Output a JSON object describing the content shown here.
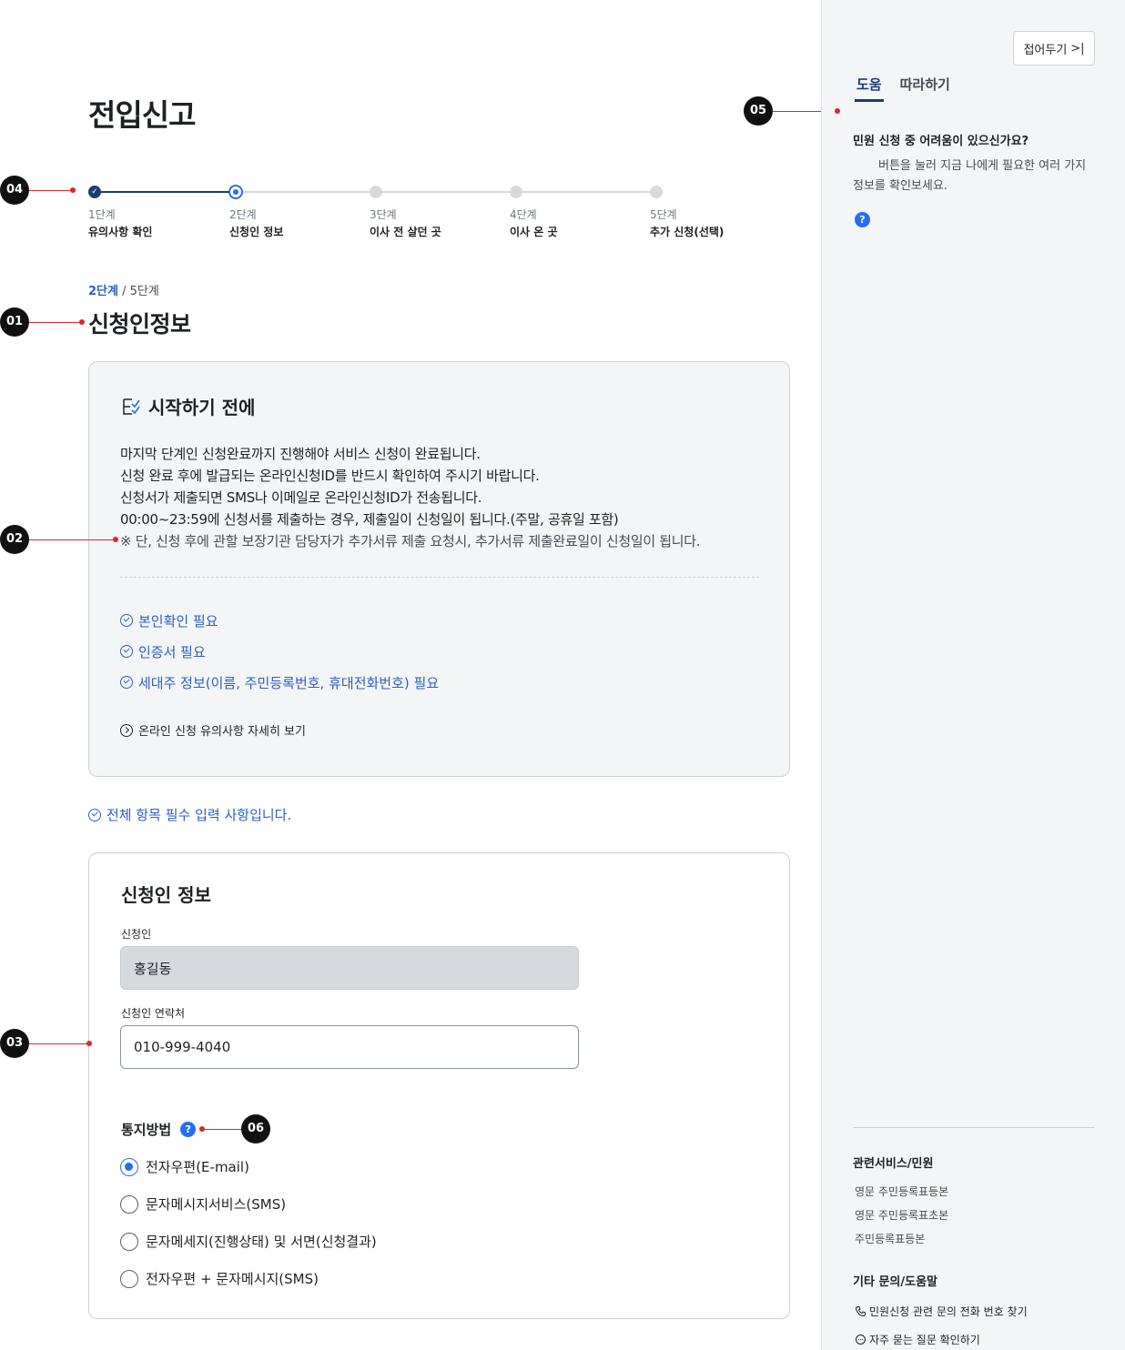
{
  "page": {
    "title": "전입신고"
  },
  "stepper": {
    "steps": [
      {
        "num": "1단계",
        "label": "유의사항 확인",
        "state": "done"
      },
      {
        "num": "2단계",
        "label": "신청인 정보",
        "state": "current"
      },
      {
        "num": "3단계",
        "label": "이사 전 살던 곳",
        "state": "todo"
      },
      {
        "num": "4단계",
        "label": "이사 온 곳",
        "state": "todo"
      },
      {
        "num": "5단계",
        "label": "추가 신청(선택)",
        "state": "todo"
      }
    ],
    "current_label": "2단계",
    "total_label": "5단계",
    "separator": "/"
  },
  "section": {
    "title": "신청인정보"
  },
  "notice": {
    "title": "시작하기 전에",
    "lines": [
      "마지막 단계인 신청완료까지 진행해야 서비스 신청이 완료됩니다.",
      "신청 완료 후에 발급되는 온라인신청ID를 반드시 확인하여 주시기 바랍니다.",
      "신청서가 제출되면 SMS나 이메일로 온라인신청ID가 전송됩니다.",
      "00:00~23:59에 신청서를 제출하는 경우, 제출일이 신청일이 됩니다.(주말, 공휴일 포함)",
      "※ 단, 신청 후에 관할 보장기관 담당자가 추가서류 제출 요청시, 추가서류 제출완료일이 신청일이 됩니다."
    ],
    "requirements": [
      "본인확인 필요",
      "인증서 필요",
      "세대주 정보(이름, 주민등록번호, 휴대전화번호) 필요"
    ],
    "more_link": "온라인 신청 유의사항 자세히 보기"
  },
  "required_note": "전체 항목 필수 입력 사항입니다.",
  "form": {
    "title": "신청인 정보",
    "applicant_label": "신청인",
    "applicant_value": "홍길동",
    "contact_label": "신청인 연락처",
    "contact_value": "010-999-4040",
    "notify_title": "통지방법",
    "notify_options": [
      {
        "label": "전자우편(E-mail)",
        "selected": true
      },
      {
        "label": "문자메시지서비스(SMS)",
        "selected": false
      },
      {
        "label": "문자메세지(진행상태) 및 서면(신청결과)",
        "selected": false
      },
      {
        "label": "전자우편 + 문자메시지(SMS)",
        "selected": false
      }
    ]
  },
  "annotations": [
    "01",
    "02",
    "03",
    "04",
    "05",
    "06"
  ],
  "side": {
    "collapse_label": "접어두기",
    "tabs": [
      "도움",
      "따라하기"
    ],
    "help_question": "민원 신청 중 어려움이 있으신가요?",
    "help_text": "버튼을 눌러 지금 나에게 필요한 여러 가지 정보를 확인보세요.",
    "related_title": "관련서비스/민원",
    "related_links": [
      "영문 주민등록표등본",
      "영문 주민등록표초본",
      "주민등록표등본"
    ],
    "etc_title": "기타 문의/도움말",
    "etc_links": [
      "민원신청 관련 문의 전화 번호 찾기",
      "자주 묻는 질문 확인하기"
    ]
  },
  "help_badge": "?",
  "colors": {
    "primary": "#256ef4",
    "navy": "#1b3b75",
    "link": "#2b5fc4",
    "annotation": "#e2232b"
  }
}
